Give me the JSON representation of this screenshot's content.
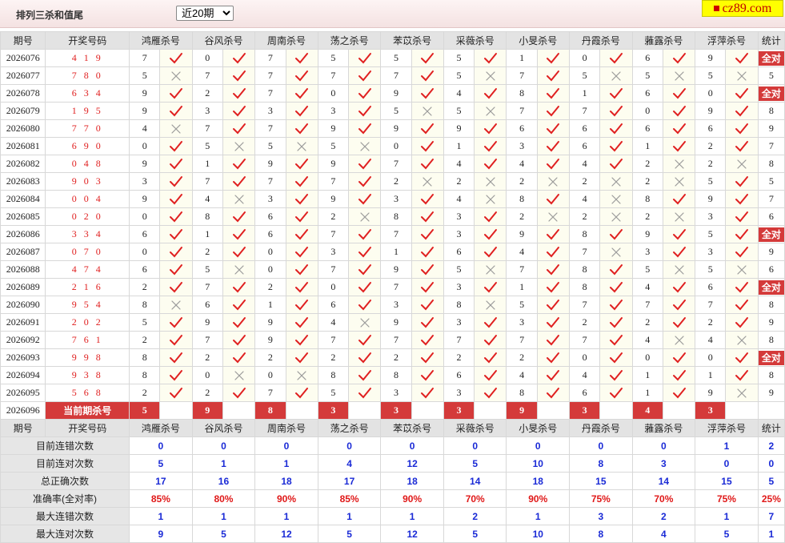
{
  "header": {
    "title": "排列三杀和值尾",
    "period_selected": "近20期",
    "logo_text": "cz89.com"
  },
  "columns": {
    "period": "期号",
    "draw": "开奖号码",
    "experts": [
      "鸿雁杀号",
      "谷风杀号",
      "周南杀号",
      "荡之杀号",
      "苯苡杀号",
      "采薇杀号",
      "小旻杀号",
      "丹霞杀号",
      "蕥露杀号",
      "浮萍杀号"
    ],
    "total": "统计"
  },
  "rows": [
    {
      "period": "2026076",
      "draw": "4 1 9",
      "picks": [
        7,
        0,
        7,
        5,
        5,
        5,
        1,
        0,
        6,
        9
      ],
      "hits": [
        1,
        1,
        1,
        1,
        1,
        1,
        1,
        1,
        1,
        1
      ],
      "total": "全对"
    },
    {
      "period": "2026077",
      "draw": "7 8 0",
      "picks": [
        5,
        7,
        7,
        7,
        7,
        5,
        7,
        5,
        5,
        5
      ],
      "hits": [
        0,
        1,
        1,
        1,
        1,
        0,
        1,
        0,
        0,
        0
      ],
      "total": "5"
    },
    {
      "period": "2026078",
      "draw": "6 3 4",
      "picks": [
        9,
        2,
        7,
        0,
        9,
        4,
        8,
        1,
        6,
        0
      ],
      "hits": [
        1,
        1,
        1,
        1,
        1,
        1,
        1,
        1,
        1,
        1
      ],
      "total": "全对"
    },
    {
      "period": "2026079",
      "draw": "1 9 5",
      "picks": [
        9,
        3,
        3,
        3,
        5,
        5,
        7,
        7,
        0,
        9
      ],
      "hits": [
        1,
        1,
        1,
        1,
        0,
        0,
        1,
        1,
        1,
        1
      ],
      "total": "8"
    },
    {
      "period": "2026080",
      "draw": "7 7 0",
      "picks": [
        4,
        7,
        7,
        9,
        9,
        9,
        6,
        6,
        6,
        6
      ],
      "hits": [
        0,
        1,
        1,
        1,
        1,
        1,
        1,
        1,
        1,
        1
      ],
      "total": "9"
    },
    {
      "period": "2026081",
      "draw": "6 9 0",
      "picks": [
        0,
        5,
        5,
        5,
        0,
        1,
        3,
        6,
        1,
        2
      ],
      "hits": [
        1,
        0,
        0,
        0,
        1,
        1,
        1,
        1,
        1,
        1
      ],
      "total": "7"
    },
    {
      "period": "2026082",
      "draw": "0 4 8",
      "picks": [
        9,
        1,
        9,
        9,
        7,
        4,
        4,
        4,
        2,
        2
      ],
      "hits": [
        1,
        1,
        1,
        1,
        1,
        1,
        1,
        1,
        0,
        0
      ],
      "total": "8"
    },
    {
      "period": "2026083",
      "draw": "9 0 3",
      "picks": [
        3,
        7,
        7,
        7,
        2,
        2,
        2,
        2,
        2,
        5
      ],
      "hits": [
        1,
        1,
        1,
        1,
        0,
        0,
        0,
        0,
        0,
        1
      ],
      "total": "5"
    },
    {
      "period": "2026084",
      "draw": "0 0 4",
      "picks": [
        9,
        4,
        3,
        9,
        3,
        4,
        8,
        4,
        8,
        9
      ],
      "hits": [
        1,
        0,
        1,
        1,
        1,
        0,
        1,
        0,
        1,
        1
      ],
      "total": "7"
    },
    {
      "period": "2026085",
      "draw": "0 2 0",
      "picks": [
        0,
        8,
        6,
        2,
        8,
        3,
        2,
        2,
        2,
        3
      ],
      "hits": [
        1,
        1,
        1,
        0,
        1,
        1,
        0,
        0,
        0,
        1
      ],
      "total": "6"
    },
    {
      "period": "2026086",
      "draw": "3 3 4",
      "picks": [
        6,
        1,
        6,
        7,
        7,
        3,
        9,
        8,
        9,
        5
      ],
      "hits": [
        1,
        1,
        1,
        1,
        1,
        1,
        1,
        1,
        1,
        1
      ],
      "total": "全对"
    },
    {
      "period": "2026087",
      "draw": "0 7 0",
      "picks": [
        0,
        2,
        0,
        3,
        1,
        6,
        4,
        7,
        3,
        3
      ],
      "hits": [
        1,
        1,
        1,
        1,
        1,
        1,
        1,
        0,
        1,
        1
      ],
      "total": "9"
    },
    {
      "period": "2026088",
      "draw": "4 7 4",
      "picks": [
        6,
        5,
        0,
        7,
        9,
        5,
        7,
        8,
        5,
        5
      ],
      "hits": [
        1,
        0,
        1,
        1,
        1,
        0,
        1,
        1,
        0,
        0
      ],
      "total": "6"
    },
    {
      "period": "2026089",
      "draw": "2 1 6",
      "picks": [
        2,
        7,
        2,
        0,
        7,
        3,
        1,
        8,
        4,
        6
      ],
      "hits": [
        1,
        1,
        1,
        1,
        1,
        1,
        1,
        1,
        1,
        1
      ],
      "total": "全对"
    },
    {
      "period": "2026090",
      "draw": "9 5 4",
      "picks": [
        8,
        6,
        1,
        6,
        3,
        8,
        5,
        7,
        7,
        7
      ],
      "hits": [
        0,
        1,
        1,
        1,
        1,
        0,
        1,
        1,
        1,
        1
      ],
      "total": "8"
    },
    {
      "period": "2026091",
      "draw": "2 0 2",
      "picks": [
        5,
        9,
        9,
        4,
        9,
        3,
        3,
        2,
        2,
        2
      ],
      "hits": [
        1,
        1,
        1,
        0,
        1,
        1,
        1,
        1,
        1,
        1
      ],
      "total": "9"
    },
    {
      "period": "2026092",
      "draw": "7 6 1",
      "picks": [
        2,
        7,
        9,
        7,
        7,
        7,
        7,
        7,
        4,
        4
      ],
      "hits": [
        1,
        1,
        1,
        1,
        1,
        1,
        1,
        1,
        0,
        0
      ],
      "total": "8"
    },
    {
      "period": "2026093",
      "draw": "9 9 8",
      "picks": [
        8,
        2,
        2,
        2,
        2,
        2,
        2,
        0,
        0,
        0
      ],
      "hits": [
        1,
        1,
        1,
        1,
        1,
        1,
        1,
        1,
        1,
        1
      ],
      "total": "全对"
    },
    {
      "period": "2026094",
      "draw": "9 3 8",
      "picks": [
        8,
        0,
        0,
        8,
        8,
        6,
        4,
        4,
        1,
        1
      ],
      "hits": [
        1,
        0,
        0,
        1,
        1,
        1,
        1,
        1,
        1,
        1
      ],
      "total": "8"
    },
    {
      "period": "2026095",
      "draw": "5 6 8",
      "picks": [
        2,
        2,
        7,
        5,
        3,
        3,
        8,
        6,
        1,
        9
      ],
      "hits": [
        1,
        1,
        1,
        1,
        1,
        1,
        1,
        1,
        1,
        0
      ],
      "total": "9"
    }
  ],
  "current": {
    "period": "2026096",
    "label": "当前期杀号",
    "picks": [
      "5",
      "9",
      "8",
      "3",
      "3",
      "3",
      "9",
      "3",
      "4",
      "3"
    ]
  },
  "stats": [
    {
      "label": "目前连错次数",
      "values": [
        "0",
        "0",
        "0",
        "0",
        "0",
        "0",
        "0",
        "0",
        "0",
        "1"
      ],
      "total": "2"
    },
    {
      "label": "目前连对次数",
      "values": [
        "5",
        "1",
        "1",
        "4",
        "12",
        "5",
        "10",
        "8",
        "3",
        "0"
      ],
      "total": "0"
    },
    {
      "label": "总正确次数",
      "values": [
        "17",
        "16",
        "18",
        "17",
        "18",
        "14",
        "18",
        "15",
        "14",
        "15"
      ],
      "total": "5"
    },
    {
      "label": "准确率(全对率)",
      "values": [
        "85%",
        "80%",
        "90%",
        "85%",
        "90%",
        "70%",
        "90%",
        "75%",
        "70%",
        "75%"
      ],
      "total": "25%",
      "rate": true
    },
    {
      "label": "最大连错次数",
      "values": [
        "1",
        "1",
        "1",
        "1",
        "1",
        "2",
        "1",
        "3",
        "2",
        "1"
      ],
      "total": "7"
    },
    {
      "label": "最大连对次数",
      "values": [
        "9",
        "5",
        "12",
        "5",
        "12",
        "5",
        "10",
        "8",
        "4",
        "5"
      ],
      "total": "1"
    }
  ],
  "icons": {
    "hit": "check-icon",
    "miss": "cross-icon"
  },
  "colors": {
    "hit": "#e02020",
    "miss": "#9a9a9a",
    "accent": "#d43a3a",
    "stat_value": "#1a2ad6",
    "rate_value": "#e01818"
  }
}
